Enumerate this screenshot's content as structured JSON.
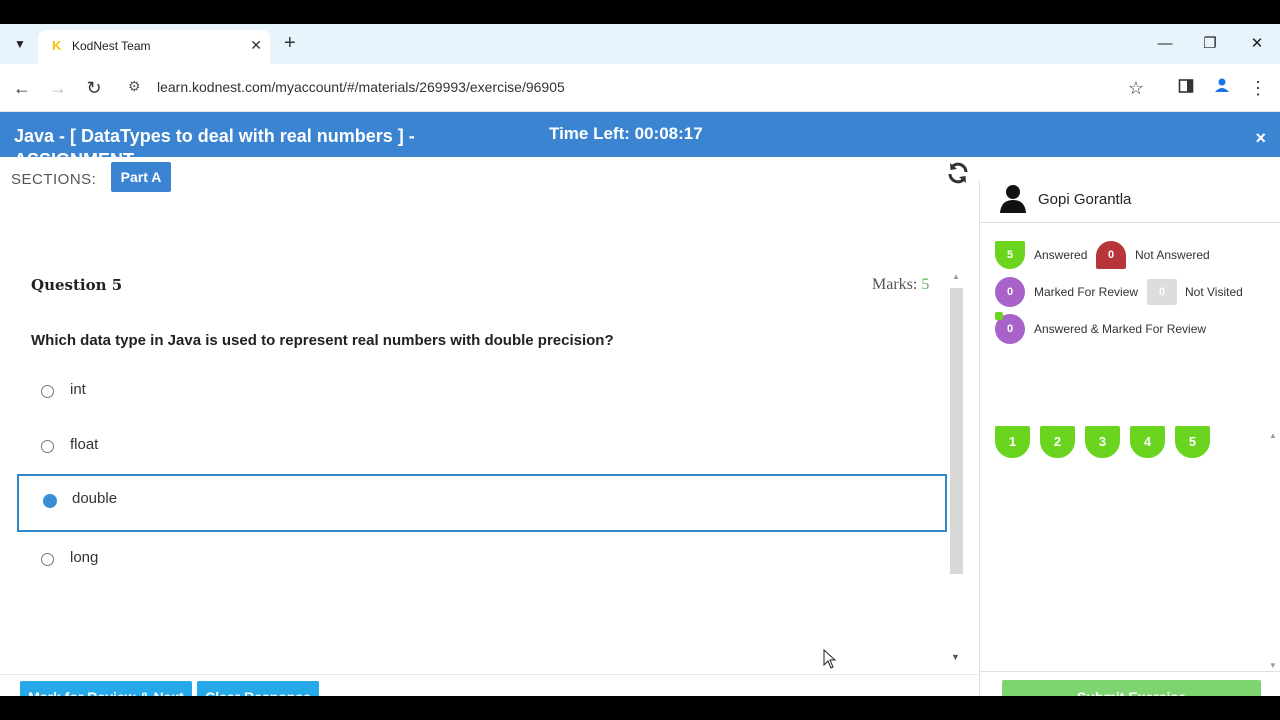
{
  "browser": {
    "tab_title": "KodNest Team",
    "tab_favicon": "K",
    "url": "learn.kodnest.com/myaccount/#/materials/269993/exercise/96905",
    "icons": [
      "tab-menu-icon",
      "new-tab-icon",
      "minimize-icon",
      "restore-icon",
      "close-window-icon",
      "back-icon",
      "forward-icon",
      "reload-icon",
      "site-settings-icon",
      "bookmark-star-icon",
      "side-panel-icon",
      "profile-icon",
      "kebab-menu-icon"
    ]
  },
  "header": {
    "title": "Java - [ DataTypes to deal with real numbers ] - ASSIGNMENT",
    "time_left": "Time Left: 00:08:17",
    "close_symbol": "×"
  },
  "sections": {
    "label": "SECTIONS:",
    "active": "Part A"
  },
  "question": {
    "number_label": "Question 5",
    "marks_label": "Marks:",
    "marks_value": "5",
    "text": "Which data type in Java is used to represent real numbers with double precision?",
    "options": [
      "int",
      "float",
      "double",
      "long"
    ],
    "selected_index": 2
  },
  "footer": {
    "mark_review_label": "Mark for Review & Next",
    "clear_label": "Clear Response"
  },
  "sidebar": {
    "user_name": "Gopi Gorantla",
    "legend": {
      "answered": {
        "count": "5",
        "label": "Answered"
      },
      "not_answered": {
        "count": "0",
        "label": "Not Answered"
      },
      "marked": {
        "count": "0",
        "label": "Marked For Review"
      },
      "not_visited": {
        "count": "0",
        "label": "Not Visited"
      },
      "answered_marked": {
        "count": "0",
        "label": "Answered & Marked For Review"
      }
    },
    "questions": [
      "1",
      "2",
      "3",
      "4",
      "5"
    ],
    "submit_label": "Submit Exercise"
  },
  "colors": {
    "header_blue": "#3a84d1",
    "answered_green": "#6ad41f",
    "not_answered_red": "#b8353a",
    "marked_purple": "#a862c8",
    "footer_button_blue": "#26a9e8",
    "submit_green": "#7ed56f"
  }
}
